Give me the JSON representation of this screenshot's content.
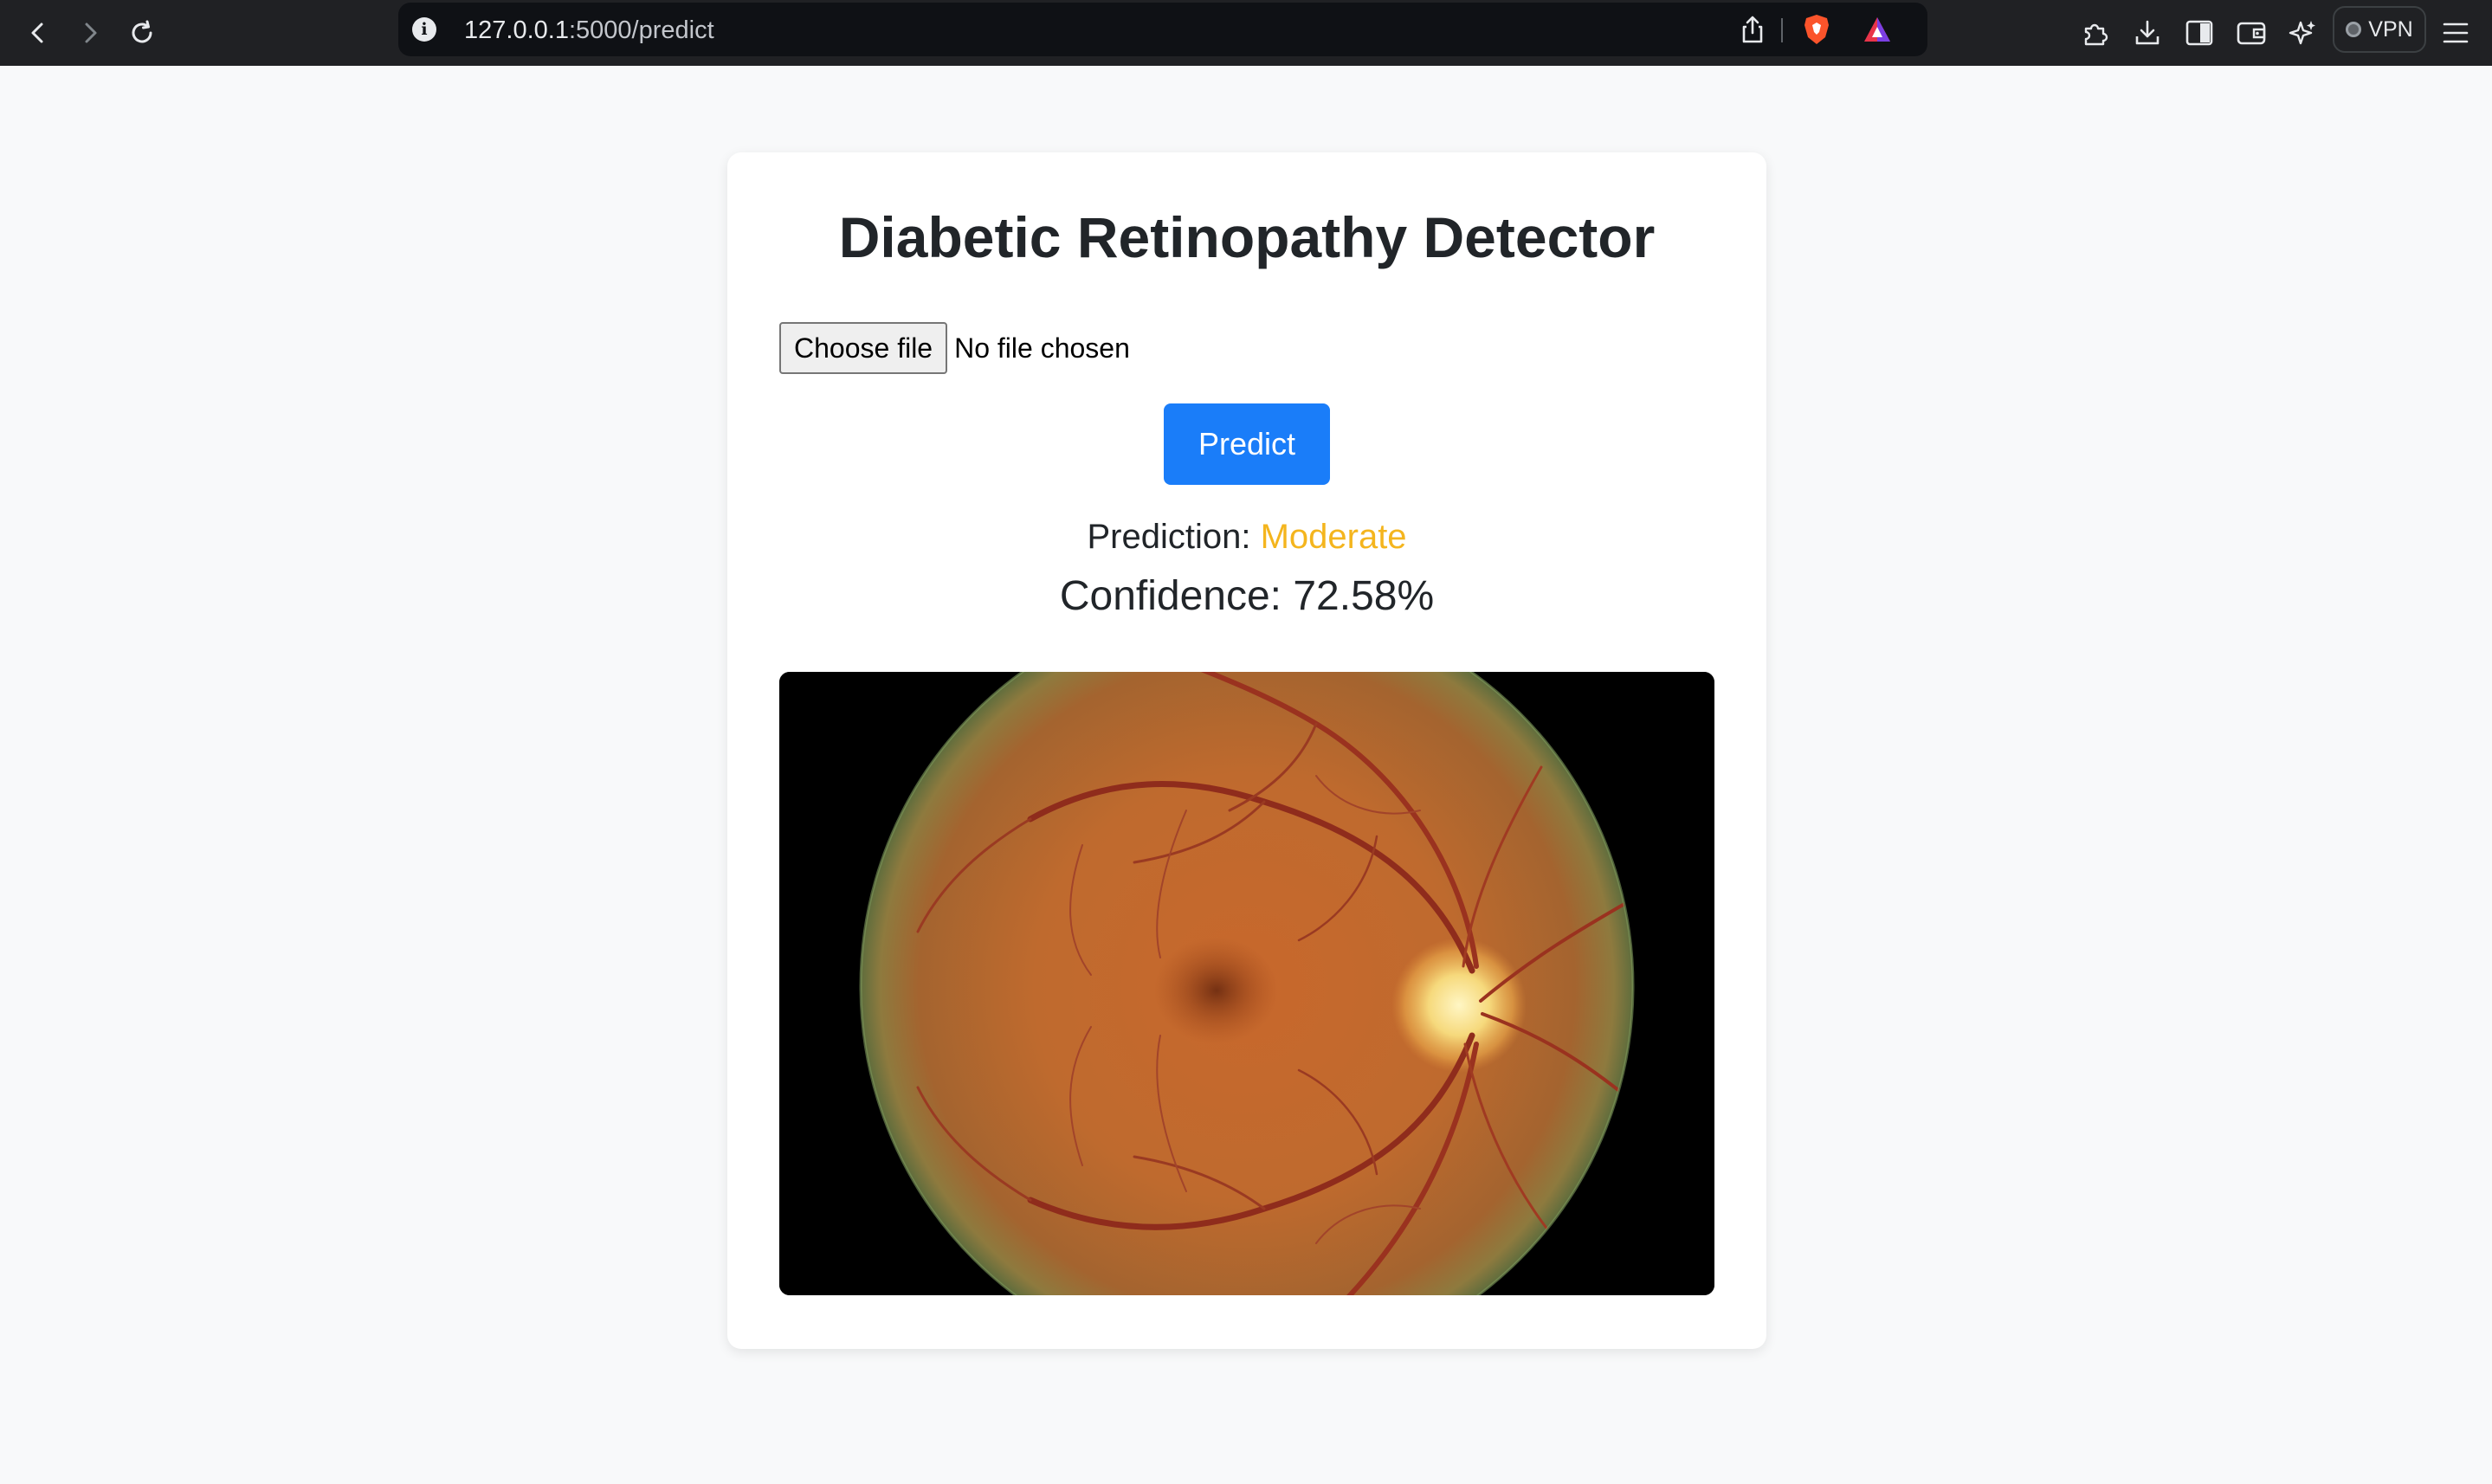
{
  "browser": {
    "url_host": "127.0.0.1",
    "url_path": ":5000/predict",
    "vpn_label": "VPN",
    "icons": [
      "back-arrow-icon",
      "forward-arrow-icon",
      "reload-icon",
      "site-info-icon",
      "share-icon",
      "brave-shields-icon",
      "brave-rewards-icon",
      "extensions-icon",
      "downloads-icon",
      "sidebar-icon",
      "wallet-icon",
      "leo-ai-icon",
      "menu-icon"
    ]
  },
  "page": {
    "title": "Diabetic Retinopathy Detector",
    "file_input": {
      "button_label": "Choose file",
      "status": "No file chosen"
    },
    "predict_button": "Predict",
    "prediction_label": "Prediction:",
    "prediction_value": "Moderate",
    "confidence_text": "Confidence: 72.58%"
  },
  "colors": {
    "accent": "#1a7df9",
    "prediction_value": "#f4b51e",
    "page_background": "#f8f9fa",
    "chrome_background": "#202124"
  }
}
